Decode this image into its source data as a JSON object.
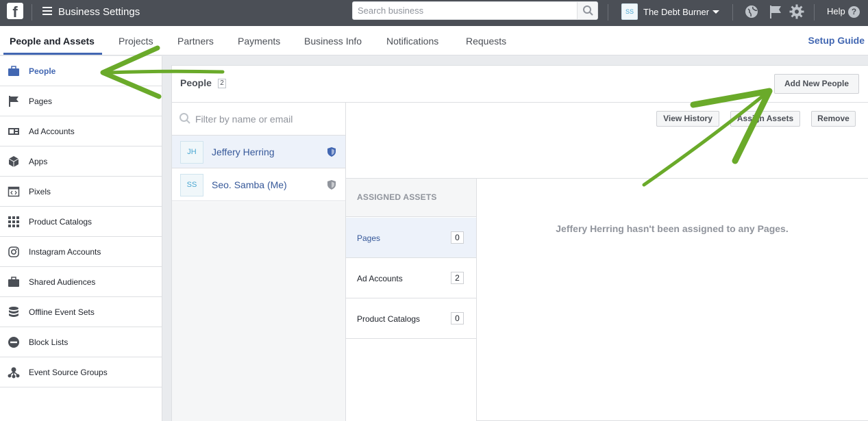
{
  "header": {
    "logo": "f",
    "title": "Business Settings",
    "search_placeholder": "Search business",
    "account_initials": "SS",
    "account_name": "The Debt Burner",
    "help_label": "Help"
  },
  "tabs": [
    "People and Assets",
    "Projects",
    "Partners",
    "Payments",
    "Business Info",
    "Notifications",
    "Requests"
  ],
  "active_tab": "People and Assets",
  "setup_guide": "Setup Guide",
  "sidebar": {
    "items": [
      {
        "label": "People",
        "icon": "briefcase-icon",
        "active": true
      },
      {
        "label": "Pages",
        "icon": "flag-icon"
      },
      {
        "label": "Ad Accounts",
        "icon": "ad-account-icon"
      },
      {
        "label": "Apps",
        "icon": "cube-icon"
      },
      {
        "label": "Pixels",
        "icon": "code-icon"
      },
      {
        "label": "Product Catalogs",
        "icon": "grid-icon"
      },
      {
        "label": "Instagram Accounts",
        "icon": "instagram-icon"
      },
      {
        "label": "Shared Audiences",
        "icon": "briefcase-icon"
      },
      {
        "label": "Offline Event Sets",
        "icon": "database-icon"
      },
      {
        "label": "Block Lists",
        "icon": "block-icon"
      },
      {
        "label": "Event Source Groups",
        "icon": "group-icon"
      }
    ]
  },
  "main": {
    "title": "People",
    "count": "2",
    "add_button": "Add New People",
    "filter_placeholder": "Filter by name or email",
    "people": [
      {
        "initials": "JH",
        "name": "Jeffery Herring",
        "selected": true,
        "shield_color": "#4267b2"
      },
      {
        "initials": "SS",
        "name": "Seo. Samba (Me)",
        "selected": false,
        "shield_color": "#90949c"
      }
    ],
    "actions": {
      "view_history": "View History",
      "assign_assets": "Assign Assets",
      "remove": "Remove"
    },
    "assigned_header": "ASSIGNED ASSETS",
    "assets": [
      {
        "label": "Pages",
        "count": "0",
        "selected": true
      },
      {
        "label": "Ad Accounts",
        "count": "2",
        "selected": false
      },
      {
        "label": "Product Catalogs",
        "count": "0",
        "selected": false
      }
    ],
    "empty_message": "Jeffery Herring hasn't been assigned to any Pages."
  },
  "colors": {
    "topbar": "#4b4f56",
    "accent": "#4267b2",
    "annotation_arrow": "#6aaa2a"
  }
}
